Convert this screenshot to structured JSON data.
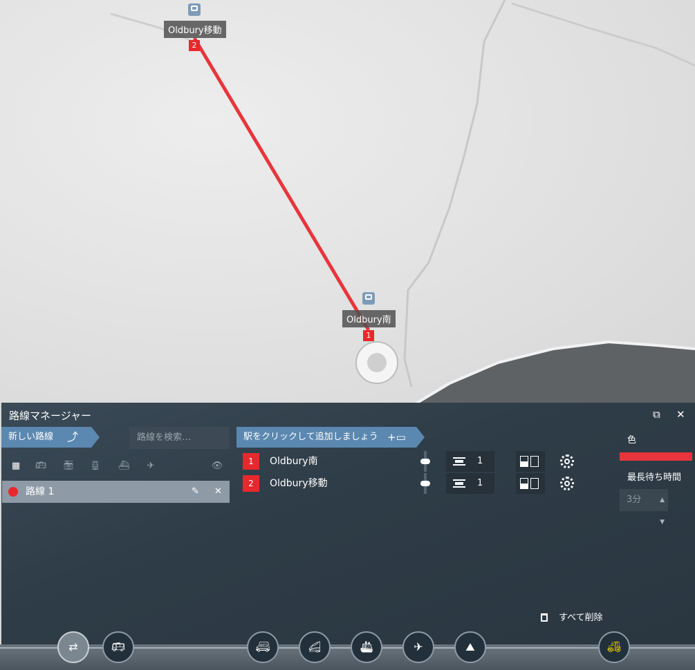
{
  "map": {
    "stations": [
      {
        "label": "Oldbury移動",
        "number": "2"
      },
      {
        "label": "Oldbury南",
        "number": "1"
      }
    ],
    "route_color": "#e8353b"
  },
  "panel": {
    "title": "路線マネージャー",
    "popout_icon": "external-link-icon",
    "close_icon": "close-icon",
    "new_line_label": "新しい路線",
    "search_placeholder": "路線を検索…",
    "filters": [
      "grid-icon",
      "bus-icon",
      "tram-icon",
      "train-icon",
      "ship-icon",
      "plane-icon",
      "eye-icon"
    ],
    "lines": [
      {
        "name": "路線 1",
        "color": "#e8282d"
      }
    ],
    "add_stop_hint": "駅をクリックして追加しましょう",
    "stops": [
      {
        "number": "1",
        "name": "Oldbury南",
        "platform": "1"
      },
      {
        "number": "2",
        "name": "Oldbury移動",
        "platform": "1"
      }
    ],
    "color_label": "色",
    "line_color": "#e8353b",
    "max_wait_label": "最長待ち時間",
    "max_wait_value": "3分",
    "delete_all_label": "すべて削除"
  },
  "toolbar": {
    "buttons": [
      "route-manager-icon",
      "bus-depot-icon",
      "bus-icon",
      "train-icon",
      "ship-icon",
      "plane-icon",
      "terrain-icon",
      "bulldozer-icon"
    ],
    "accent": "#f0d000"
  }
}
